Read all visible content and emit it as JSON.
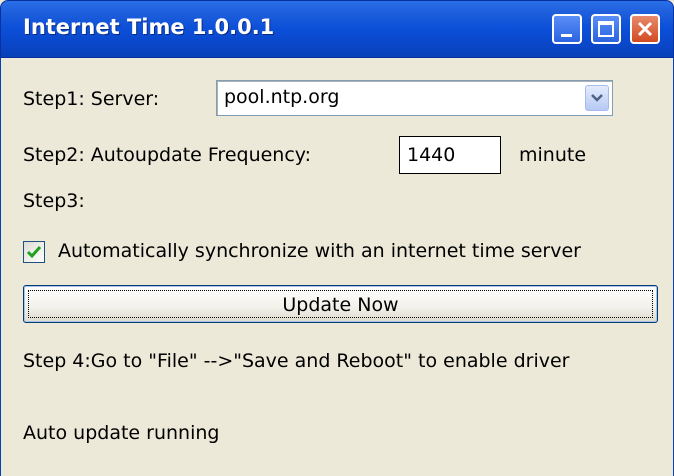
{
  "window": {
    "title": "Internet Time 1.0.0.1",
    "buttons": {
      "minimize_icon": "minimize-icon",
      "maximize_icon": "maximize-icon",
      "close_icon": "close-icon"
    }
  },
  "step1": {
    "label": "Step1: Server:",
    "server_value": "pool.ntp.org",
    "dropdown_icon": "chevron-down-icon"
  },
  "step2": {
    "label": "Step2: Autoupdate Frequency:",
    "frequency_value": "1440",
    "unit": "minute"
  },
  "step3": {
    "label": "Step3:",
    "checkbox_checked": true,
    "checkbox_label": "Automatically synchronize with an internet time server"
  },
  "update_button": {
    "label": "Update Now"
  },
  "step4": {
    "text": "Step 4:Go to \"File\" -->\"Save and Reboot\" to enable driver"
  },
  "status": {
    "text": "Auto update running"
  },
  "colors": {
    "titlebar": "#0b4fd8",
    "close_button": "#d24a22",
    "window_body": "#ece9d8",
    "checkmark": "#21a121"
  }
}
